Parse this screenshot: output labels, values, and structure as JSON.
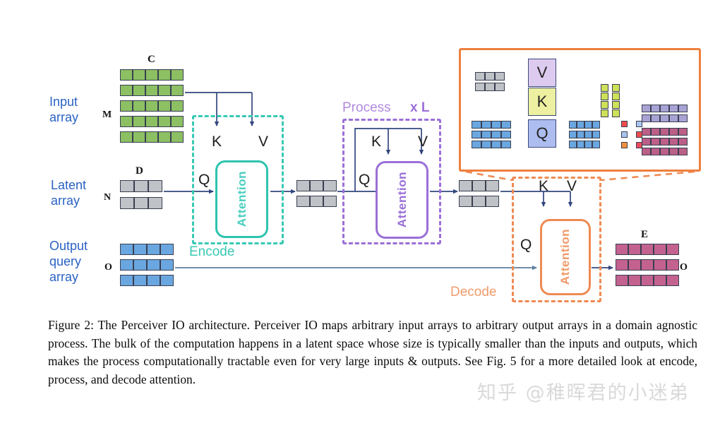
{
  "figure": {
    "title": "Perceiver IO architecture diagram",
    "caption": "Figure 2: The Perceiver IO architecture. Perceiver IO maps arbitrary input arrays to arbitrary output arrays in a domain agnostic process. The bulk of the computation happens in a latent space whose size is typically smaller than the inputs and outputs, which makes the process computationally tractable even for very large inputs & outputs. See Fig. 5 for a more detailed look at encode, process, and decode attention.",
    "watermark": "知乎 @稚晖君的小迷弟"
  },
  "colors": {
    "label_blue": "#2a62c4",
    "input_green": "#8cc063",
    "latent_gray": "#bfc2c6",
    "query_blue": "#6aa7e0",
    "output_pink": "#c4628f",
    "encode_teal": "#38c9b4",
    "process_purple": "#9b6fd8",
    "decode_orange": "#ef8a52",
    "arrow_navy": "#33477e",
    "inset_border": "#ef7f3e",
    "lavender": "#a8a3d4",
    "yellow_green": "#cfe05a"
  },
  "arrays": {
    "input": {
      "row_label": "Input array",
      "dim_top": "C",
      "dim_side": "M",
      "rows": 5,
      "cols": 5,
      "color_class": "c-green"
    },
    "latent": {
      "row_label": "Latent array",
      "dim_top": "D",
      "dim_side": "N",
      "rows": 2,
      "cols": 3,
      "color_class": "c-gray"
    },
    "output_query": {
      "row_label": "Output query array",
      "dim_top": "",
      "dim_side": "O",
      "rows": 3,
      "cols": 4,
      "color_class": "c-blue"
    },
    "latent_mid_1": {
      "rows": 2,
      "cols": 3,
      "color_class": "c-gray"
    },
    "latent_mid_2": {
      "rows": 2,
      "cols": 3,
      "color_class": "c-gray"
    },
    "output": {
      "dim_top": "E",
      "dim_side": "O",
      "rows": 3,
      "cols": 5,
      "color_class": "c-pink"
    }
  },
  "stages": {
    "encode": {
      "label": "Encode",
      "attention_label": "Attention",
      "q": "Q",
      "k": "K",
      "v": "V"
    },
    "process": {
      "label": "Process",
      "repeat": "x L",
      "attention_label": "Attention",
      "q": "Q",
      "k": "K",
      "v": "V"
    },
    "decode": {
      "label": "Decode",
      "attention_label": "Attention",
      "q": "Q",
      "k": "K",
      "v": "V"
    }
  },
  "inset": {
    "name": "attention-detail-panel",
    "v_label": "V",
    "k_label": "K",
    "q_label": "Q",
    "source_latent": {
      "rows": 2,
      "cols": 3,
      "color_class": "c-gray"
    },
    "source_query": {
      "rows": 3,
      "cols": 4,
      "color_class": "c-blue"
    },
    "keys_out": {
      "rows": 4,
      "cols": 2,
      "color_class": "c-yellow"
    },
    "queries_out": {
      "rows": 3,
      "cols": 4,
      "color_class": "c-blue"
    },
    "attention_map": {
      "rows": 3,
      "cols": 2,
      "cells": [
        [
          "#ef4d4d",
          "#aac6ef"
        ],
        [
          "#aac6ef",
          "#ef4d4d"
        ],
        [
          "#f4903c",
          "#ee4a5d"
        ]
      ]
    },
    "values_out": {
      "rows": 2,
      "cols": 5,
      "color_class": "c-lav"
    },
    "result_out": {
      "rows": 3,
      "cols": 5,
      "color_class": "c-magenta"
    }
  }
}
